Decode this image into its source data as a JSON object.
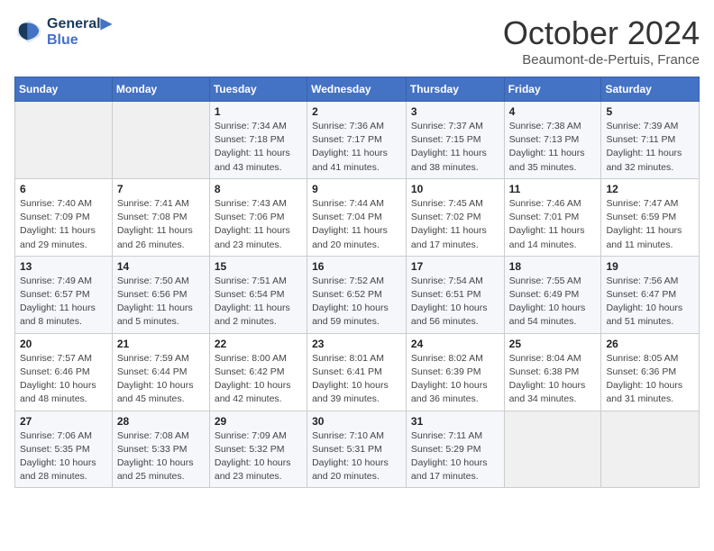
{
  "header": {
    "logo_line1": "General",
    "logo_line2": "Blue",
    "month": "October 2024",
    "location": "Beaumont-de-Pertuis, France"
  },
  "weekdays": [
    "Sunday",
    "Monday",
    "Tuesday",
    "Wednesday",
    "Thursday",
    "Friday",
    "Saturday"
  ],
  "weeks": [
    [
      {
        "day": "",
        "info": ""
      },
      {
        "day": "",
        "info": ""
      },
      {
        "day": "1",
        "info": "Sunrise: 7:34 AM\nSunset: 7:18 PM\nDaylight: 11 hours and 43 minutes."
      },
      {
        "day": "2",
        "info": "Sunrise: 7:36 AM\nSunset: 7:17 PM\nDaylight: 11 hours and 41 minutes."
      },
      {
        "day": "3",
        "info": "Sunrise: 7:37 AM\nSunset: 7:15 PM\nDaylight: 11 hours and 38 minutes."
      },
      {
        "day": "4",
        "info": "Sunrise: 7:38 AM\nSunset: 7:13 PM\nDaylight: 11 hours and 35 minutes."
      },
      {
        "day": "5",
        "info": "Sunrise: 7:39 AM\nSunset: 7:11 PM\nDaylight: 11 hours and 32 minutes."
      }
    ],
    [
      {
        "day": "6",
        "info": "Sunrise: 7:40 AM\nSunset: 7:09 PM\nDaylight: 11 hours and 29 minutes."
      },
      {
        "day": "7",
        "info": "Sunrise: 7:41 AM\nSunset: 7:08 PM\nDaylight: 11 hours and 26 minutes."
      },
      {
        "day": "8",
        "info": "Sunrise: 7:43 AM\nSunset: 7:06 PM\nDaylight: 11 hours and 23 minutes."
      },
      {
        "day": "9",
        "info": "Sunrise: 7:44 AM\nSunset: 7:04 PM\nDaylight: 11 hours and 20 minutes."
      },
      {
        "day": "10",
        "info": "Sunrise: 7:45 AM\nSunset: 7:02 PM\nDaylight: 11 hours and 17 minutes."
      },
      {
        "day": "11",
        "info": "Sunrise: 7:46 AM\nSunset: 7:01 PM\nDaylight: 11 hours and 14 minutes."
      },
      {
        "day": "12",
        "info": "Sunrise: 7:47 AM\nSunset: 6:59 PM\nDaylight: 11 hours and 11 minutes."
      }
    ],
    [
      {
        "day": "13",
        "info": "Sunrise: 7:49 AM\nSunset: 6:57 PM\nDaylight: 11 hours and 8 minutes."
      },
      {
        "day": "14",
        "info": "Sunrise: 7:50 AM\nSunset: 6:56 PM\nDaylight: 11 hours and 5 minutes."
      },
      {
        "day": "15",
        "info": "Sunrise: 7:51 AM\nSunset: 6:54 PM\nDaylight: 11 hours and 2 minutes."
      },
      {
        "day": "16",
        "info": "Sunrise: 7:52 AM\nSunset: 6:52 PM\nDaylight: 10 hours and 59 minutes."
      },
      {
        "day": "17",
        "info": "Sunrise: 7:54 AM\nSunset: 6:51 PM\nDaylight: 10 hours and 56 minutes."
      },
      {
        "day": "18",
        "info": "Sunrise: 7:55 AM\nSunset: 6:49 PM\nDaylight: 10 hours and 54 minutes."
      },
      {
        "day": "19",
        "info": "Sunrise: 7:56 AM\nSunset: 6:47 PM\nDaylight: 10 hours and 51 minutes."
      }
    ],
    [
      {
        "day": "20",
        "info": "Sunrise: 7:57 AM\nSunset: 6:46 PM\nDaylight: 10 hours and 48 minutes."
      },
      {
        "day": "21",
        "info": "Sunrise: 7:59 AM\nSunset: 6:44 PM\nDaylight: 10 hours and 45 minutes."
      },
      {
        "day": "22",
        "info": "Sunrise: 8:00 AM\nSunset: 6:42 PM\nDaylight: 10 hours and 42 minutes."
      },
      {
        "day": "23",
        "info": "Sunrise: 8:01 AM\nSunset: 6:41 PM\nDaylight: 10 hours and 39 minutes."
      },
      {
        "day": "24",
        "info": "Sunrise: 8:02 AM\nSunset: 6:39 PM\nDaylight: 10 hours and 36 minutes."
      },
      {
        "day": "25",
        "info": "Sunrise: 8:04 AM\nSunset: 6:38 PM\nDaylight: 10 hours and 34 minutes."
      },
      {
        "day": "26",
        "info": "Sunrise: 8:05 AM\nSunset: 6:36 PM\nDaylight: 10 hours and 31 minutes."
      }
    ],
    [
      {
        "day": "27",
        "info": "Sunrise: 7:06 AM\nSunset: 5:35 PM\nDaylight: 10 hours and 28 minutes."
      },
      {
        "day": "28",
        "info": "Sunrise: 7:08 AM\nSunset: 5:33 PM\nDaylight: 10 hours and 25 minutes."
      },
      {
        "day": "29",
        "info": "Sunrise: 7:09 AM\nSunset: 5:32 PM\nDaylight: 10 hours and 23 minutes."
      },
      {
        "day": "30",
        "info": "Sunrise: 7:10 AM\nSunset: 5:31 PM\nDaylight: 10 hours and 20 minutes."
      },
      {
        "day": "31",
        "info": "Sunrise: 7:11 AM\nSunset: 5:29 PM\nDaylight: 10 hours and 17 minutes."
      },
      {
        "day": "",
        "info": ""
      },
      {
        "day": "",
        "info": ""
      }
    ]
  ]
}
